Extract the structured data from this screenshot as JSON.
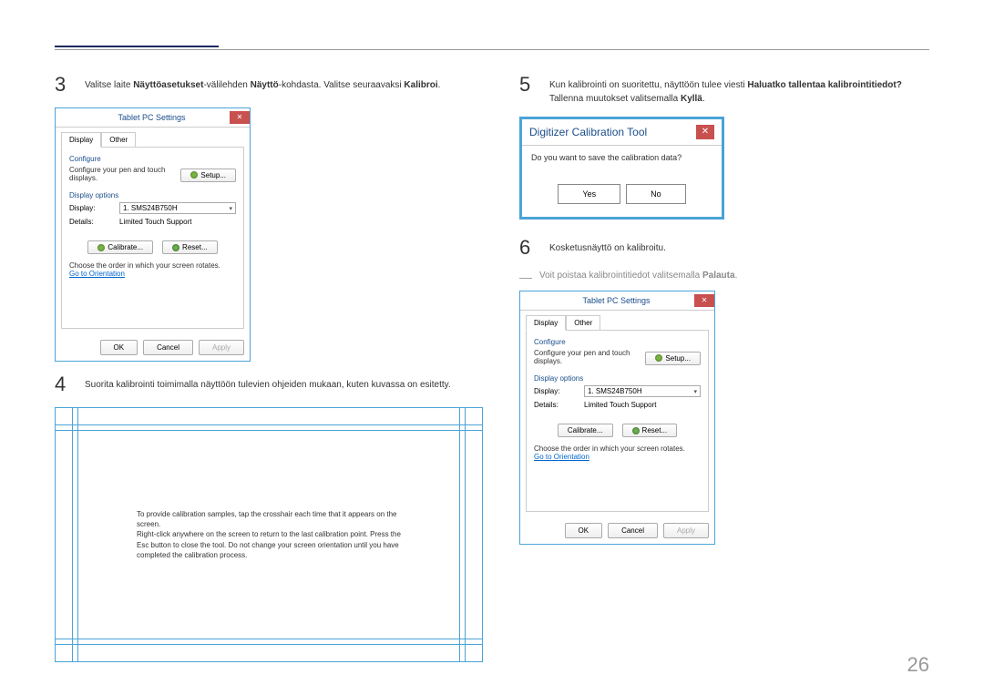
{
  "step3": {
    "num": "3",
    "text_pre": "Valitse laite ",
    "bold1": "Näyttöasetukset",
    "text_mid1": "-välilehden ",
    "bold2": "Näyttö",
    "text_mid2": "-kohdasta. Valitse seuraavaksi ",
    "bold3": "Kalibroi",
    "text_post": "."
  },
  "tablet_settings": {
    "title": "Tablet PC Settings",
    "tab1": "Display",
    "tab2": "Other",
    "configure": "Configure",
    "config_text": "Configure your pen and touch displays.",
    "setup_btn": "Setup...",
    "display_options": "Display options",
    "display_label": "Display:",
    "display_value": "1. SMS24B750H",
    "details_label": "Details:",
    "details_value": "Limited Touch Support",
    "calibrate_btn": "Calibrate...",
    "reset_btn": "Reset...",
    "orientation_text": "Choose the order in which your screen rotates.",
    "orientation_link": "Go to Orientation",
    "ok": "OK",
    "cancel": "Cancel",
    "apply": "Apply"
  },
  "step4": {
    "num": "4",
    "text": "Suorita kalibrointi toimimalla näyttöön tulevien ohjeiden mukaan, kuten kuvassa on esitetty."
  },
  "calib": {
    "text": "To provide calibration samples, tap the crosshair each time that it appears on the screen.\nRight-click anywhere on the screen to return to the last calibration point. Press the Esc button to close the tool. Do not change your screen orientation until you have completed the calibration process."
  },
  "step5": {
    "num": "5",
    "text_pre": "Kun kalibrointi on suoritettu, näyttöön tulee viesti ",
    "bold1": "Haluatko tallentaa kalibrointitiedot?",
    "text_mid": " Tallenna muutokset valitsemalla ",
    "bold2": "Kyllä",
    "text_post": "."
  },
  "dialog": {
    "title": "Digitizer Calibration Tool",
    "msg": "Do you want to save the calibration data?",
    "yes": "Yes",
    "no": "No"
  },
  "step6": {
    "num": "6",
    "text": "Kosketusnäyttö on kalibroitu."
  },
  "dash_note": {
    "text_pre": "Voit poistaa kalibrointitiedot valitsemalla ",
    "bold": "Palauta",
    "text_post": "."
  },
  "page_num": "26"
}
